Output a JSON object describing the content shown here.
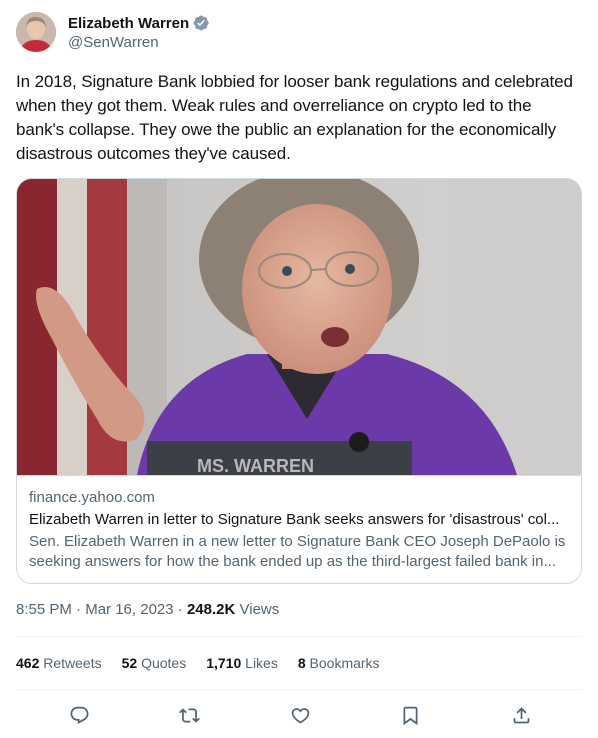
{
  "author": {
    "name": "Elizabeth Warren",
    "handle": "@SenWarren",
    "verified_badge_color": "#829aab"
  },
  "tweet": {
    "text": "In 2018, Signature Bank lobbied for looser bank regulations and celebrated when they got them. Weak rules and overreliance on crypto led to the bank's collapse. They owe the public an explanation for the economically disastrous outcomes they've caused."
  },
  "card": {
    "domain": "finance.yahoo.com",
    "title": "Elizabeth Warren in letter to Signature Bank seeks answers for 'disastrous' col...",
    "description": "Sen. Elizabeth Warren in a new letter to Signature Bank CEO Joseph DePaolo is seeking answers for how the bank ended up as the third-largest failed bank in...",
    "nameplate_text": "MS. WARREN"
  },
  "meta": {
    "time": "8:55 PM",
    "separator": "·",
    "date": "Mar 16, 2023",
    "views_count": "248.2K",
    "views_label": "Views"
  },
  "stats": {
    "retweets_count": "462",
    "retweets_label": "Retweets",
    "quotes_count": "52",
    "quotes_label": "Quotes",
    "likes_count": "1,710",
    "likes_label": "Likes",
    "bookmarks_count": "8",
    "bookmarks_label": "Bookmarks"
  },
  "actions": {
    "icons": [
      "reply-icon",
      "retweet-icon",
      "like-icon",
      "bookmark-icon",
      "share-icon"
    ],
    "icon_color": "#536471"
  },
  "colors": {
    "text_primary": "#0f1419",
    "text_secondary": "#536471",
    "border": "#cfd9de",
    "divider": "#eff3f4"
  }
}
